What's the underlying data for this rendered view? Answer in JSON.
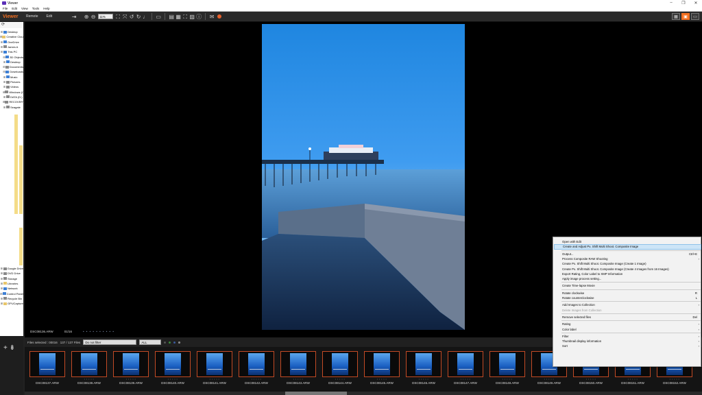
{
  "window": {
    "title": "Viewer"
  },
  "menubar": [
    "File",
    "Edit",
    "View",
    "Tools",
    "Help"
  ],
  "toolbar": {
    "brand": "Viewer",
    "tabs": [
      "Remote",
      "Edit"
    ],
    "zoom": "11%"
  },
  "sidebar": {
    "items": [
      {
        "label": "Desktop",
        "icon": "blue"
      },
      {
        "label": "Creative Cloud Files",
        "icon": "yellow"
      },
      {
        "label": "OneDrive",
        "icon": "blue"
      },
      {
        "label": "James A",
        "icon": "grey"
      },
      {
        "label": "This PC",
        "icon": "blue"
      },
      {
        "label": "3D Objects",
        "icon": "blue"
      },
      {
        "label": "Desktop",
        "icon": "blue"
      },
      {
        "label": "Documents",
        "icon": "grey"
      },
      {
        "label": "Downloads",
        "icon": "blue"
      },
      {
        "label": "Music",
        "icon": "blue"
      },
      {
        "label": "Pictures",
        "icon": "grey"
      },
      {
        "label": "Videos",
        "icon": "grey"
      },
      {
        "label": "Windows (C:)",
        "icon": "grey"
      },
      {
        "label": "DATA (D:)",
        "icon": "grey"
      },
      {
        "label": "RECOVERY",
        "icon": "grey"
      },
      {
        "label": "Seagate",
        "icon": "grey"
      }
    ],
    "bottom_items": [
      {
        "label": "Google Drive",
        "icon": "grey"
      },
      {
        "label": "DVD Drive",
        "icon": "grey"
      },
      {
        "label": "Storage",
        "icon": "grey"
      },
      {
        "label": "Libraries",
        "icon": "yellow"
      },
      {
        "label": "Network",
        "icon": "blue"
      },
      {
        "label": "Control Panel",
        "icon": "blue"
      },
      {
        "label": "Recycle Bin",
        "icon": "grey"
      },
      {
        "label": "GPUCapture",
        "icon": "yellow"
      }
    ]
  },
  "viewer": {
    "filename": "DSC08136.ARW",
    "info": "01/16",
    "rating_dots": "• • • • •   • • • • •"
  },
  "filterbar": {
    "files_selected": "Files selected : 00016",
    "count": "137 / 137 Files",
    "filter": "Do not filter",
    "all": "ALL"
  },
  "thumbnails": [
    "DSC08137.ARW",
    "DSC08138.ARW",
    "DSC08139.ARW",
    "DSC08140.ARW",
    "DSC08141.ARW",
    "DSC08142.ARW",
    "DSC08143.ARW",
    "DSC08144.ARW",
    "DSC08145.ARW",
    "DSC08146.ARW",
    "DSC08147.ARW",
    "DSC08148.ARW",
    "DSC08149.ARW",
    "DSC08150.ARW",
    "DSC08151.ARW",
    "DSC08152.ARW"
  ],
  "context_menu": {
    "items": [
      {
        "label": "Open with Edit"
      },
      {
        "label": "Create and Adjust Px. Shift Multi Shoot. Composite Image",
        "highlight": true
      },
      {
        "divider": true
      },
      {
        "label": "Output...",
        "shortcut": "Ctrl+E"
      },
      {
        "label": "Process Composite RAW Shooting",
        "submenu": true
      },
      {
        "label": "Create Px. Shift Multi Shoot. Composite Image (Create 1 Image)"
      },
      {
        "label": "Create Px. Shift Multi Shoot. Composite Image (Create 4 Images from 16 Images)"
      },
      {
        "label": "Export Rating, Color Label to XMP Information"
      },
      {
        "label": "Apply image process setting..."
      },
      {
        "divider": true
      },
      {
        "label": "Create Time-lapse Movie"
      },
      {
        "divider": true
      },
      {
        "label": "Rotate clockwise",
        "shortcut": "R"
      },
      {
        "label": "Rotate counterclockwise",
        "shortcut": "L"
      },
      {
        "divider": true
      },
      {
        "label": "Add Images to Collection",
        "submenu": true
      },
      {
        "label": "Delete Images from Collection",
        "disabled": true
      },
      {
        "divider": true
      },
      {
        "label": "Remove selected files",
        "shortcut": "Del"
      },
      {
        "divider": true
      },
      {
        "label": "Rating",
        "submenu": true
      },
      {
        "label": "Color label",
        "submenu": true
      },
      {
        "divider": true
      },
      {
        "label": "Filter",
        "submenu": true
      },
      {
        "label": "Thumbnail display information",
        "submenu": true
      },
      {
        "label": "Sort",
        "submenu": true
      }
    ]
  },
  "colors": {
    "accent": "#f37021",
    "thumb_border": "#c44b25"
  }
}
